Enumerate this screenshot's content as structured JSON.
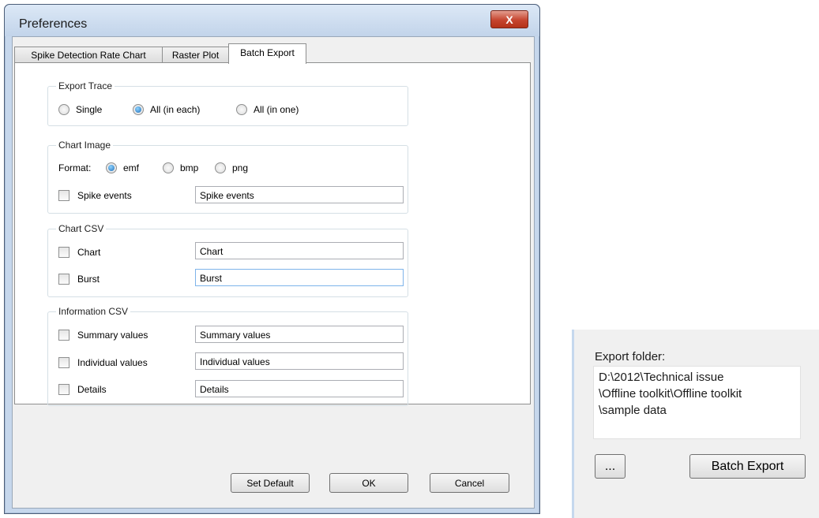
{
  "window": {
    "title": "Preferences",
    "close_glyph": "X"
  },
  "tabs": [
    {
      "label": "Spike Detection Rate Chart",
      "active": false
    },
    {
      "label": "Raster Plot",
      "active": false
    },
    {
      "label": "Batch Export",
      "active": true
    }
  ],
  "export_trace": {
    "legend": "Export Trace",
    "options": [
      {
        "label": "Single",
        "checked": false
      },
      {
        "label": "All (in each)",
        "checked": true
      },
      {
        "label": "All (in one)",
        "checked": false
      }
    ]
  },
  "chart_image": {
    "legend": "Chart Image",
    "format_label": "Format:",
    "formats": [
      {
        "label": "emf",
        "checked": true
      },
      {
        "label": "bmp",
        "checked": false
      },
      {
        "label": "png",
        "checked": false
      }
    ],
    "rows": [
      {
        "label": "Spike events",
        "value": "Spike events",
        "checked": false
      }
    ]
  },
  "chart_csv": {
    "legend": "Chart CSV",
    "rows": [
      {
        "label": "Chart",
        "value": "Chart",
        "checked": false
      },
      {
        "label": "Burst",
        "value": "Burst",
        "checked": false
      }
    ]
  },
  "information_csv": {
    "legend": "Information CSV",
    "rows": [
      {
        "label": "Summary values",
        "value": "Summary values",
        "checked": false
      },
      {
        "label": "Individual values",
        "value": "Individual values",
        "checked": false
      },
      {
        "label": "Details",
        "value": "Details",
        "checked": false
      }
    ]
  },
  "buttons": {
    "set_default": "Set Default",
    "ok": "OK",
    "cancel": "Cancel"
  },
  "side_panel": {
    "export_folder_label": "Export folder:",
    "export_folder_path": "D:\\2012\\Technical issue\n\\Offline toolkit\\Offline toolkit\n\\sample data",
    "browse_label": "...",
    "batch_export_label": "Batch Export"
  },
  "colors": {
    "window_frame": "#c6d7ec",
    "close_button": "#c6452f",
    "radio_selected": "#1f6fb8"
  }
}
